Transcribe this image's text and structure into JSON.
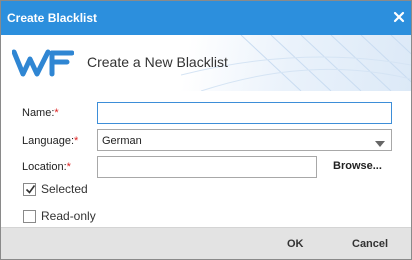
{
  "window": {
    "title": "Create Blacklist",
    "close_icon": "close-icon"
  },
  "banner": {
    "heading": "Create a New Blacklist",
    "logo_icon": "wf-logo"
  },
  "form": {
    "name": {
      "label": "Name:",
      "required_mark": "*",
      "value": ""
    },
    "language": {
      "label": "Language:",
      "required_mark": "*",
      "selected": "German"
    },
    "location": {
      "label": "Location:",
      "required_mark": "*",
      "value": "",
      "browse_label": "Browse..."
    },
    "selected": {
      "label": "Selected",
      "checked": true
    },
    "readonly": {
      "label": "Read-only",
      "checked": false
    }
  },
  "footer": {
    "ok_label": "OK",
    "cancel_label": "Cancel"
  },
  "colors": {
    "titlebar": "#2c8fdd",
    "accent": "#3d8ed8",
    "required": "#dd2222"
  }
}
